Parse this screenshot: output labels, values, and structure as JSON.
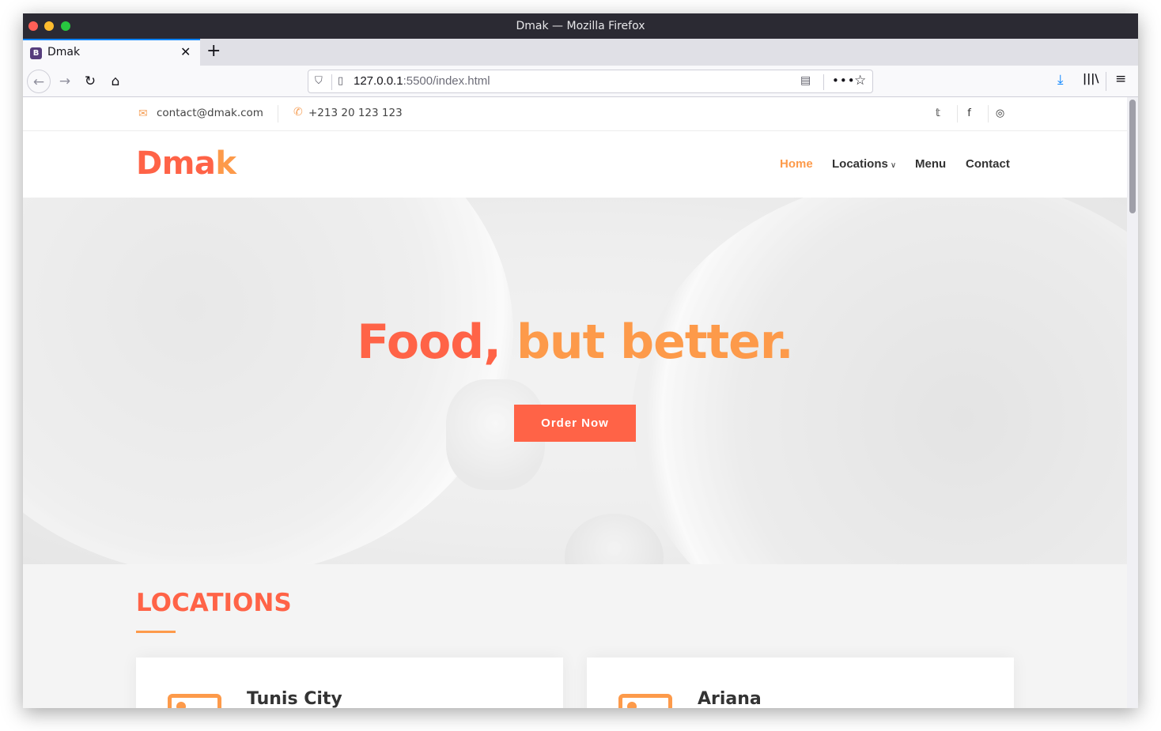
{
  "window": {
    "title": "Dmak — Mozilla Firefox"
  },
  "tab": {
    "title": "Dmak",
    "favicon_letter": "B"
  },
  "toolbar": {
    "url_host": "127.0.0.1",
    "url_rest": ":5500/index.html",
    "more_label": "•••"
  },
  "topbar": {
    "email": "contact@dmak.com",
    "phone": "+213 20 123 123",
    "social": {
      "twitter": "𝕥",
      "facebook": "f",
      "instagram": "◎"
    }
  },
  "header": {
    "logo_main": "Dma",
    "logo_accent": "k",
    "nav": [
      {
        "label": "Home"
      },
      {
        "label": "Locations"
      },
      {
        "label": "Menu"
      },
      {
        "label": "Contact"
      }
    ]
  },
  "hero": {
    "title_part1": "Food,",
    "title_part2": "but better.",
    "button_label": "Order Now"
  },
  "locations": {
    "heading": "LOCATIONS",
    "cards": [
      {
        "name": "Tunis City"
      },
      {
        "name": "Ariana"
      }
    ]
  },
  "colors": {
    "primary": "#ff6347",
    "accent": "#fd9a4a",
    "text": "#333333",
    "section_bg": "#f4f4f4"
  }
}
